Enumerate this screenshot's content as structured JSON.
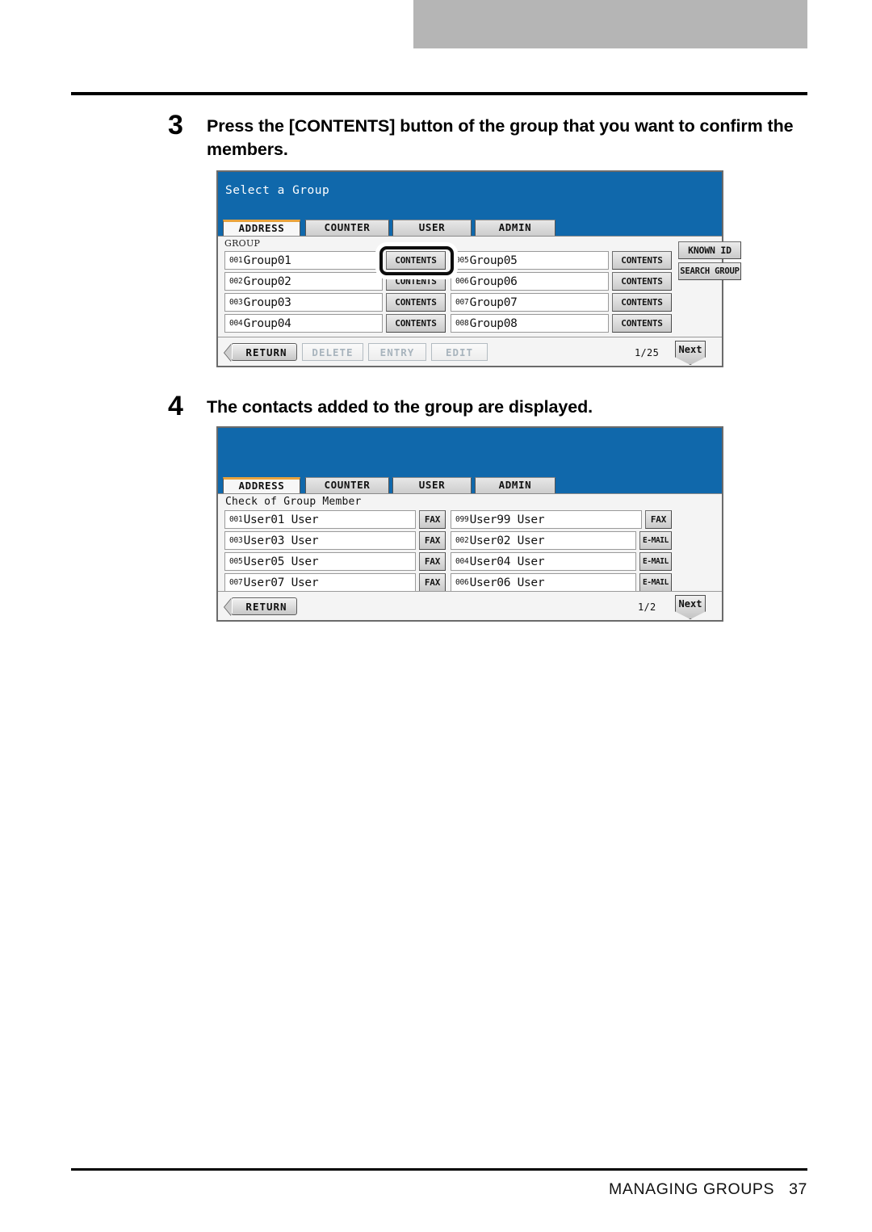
{
  "footer": {
    "chapter": "MANAGING GROUPS",
    "page_number": "37"
  },
  "steps": [
    {
      "number": "3",
      "text": "Press the [CONTENTS] button of the group that you want to confirm the members."
    },
    {
      "number": "4",
      "text": "The contacts added to the group are displayed."
    }
  ],
  "panel1": {
    "header_title": "Select a Group",
    "tabs": [
      {
        "label": "ADDRESS",
        "active": true
      },
      {
        "label": "COUNTER",
        "active": false
      },
      {
        "label": "USER",
        "active": false
      },
      {
        "label": "ADMIN",
        "active": false
      }
    ],
    "section_label": "GROUP",
    "left_rows": [
      {
        "index": "001",
        "name": "Group01",
        "button": "CONTENTS"
      },
      {
        "index": "002",
        "name": "Group02",
        "button": "CONTENTS"
      },
      {
        "index": "003",
        "name": "Group03",
        "button": "CONTENTS"
      },
      {
        "index": "004",
        "name": "Group04",
        "button": "CONTENTS"
      }
    ],
    "right_rows": [
      {
        "index": "005",
        "name": "Group05",
        "button": "CONTENTS"
      },
      {
        "index": "006",
        "name": "Group06",
        "button": "CONTENTS"
      },
      {
        "index": "007",
        "name": "Group07",
        "button": "CONTENTS"
      },
      {
        "index": "008",
        "name": "Group08",
        "button": "CONTENTS"
      }
    ],
    "side_buttons": [
      {
        "label": "KNOWN ID"
      },
      {
        "label": "SEARCH GROUP"
      }
    ],
    "footer_buttons": [
      {
        "label": "RETURN",
        "enabled": true
      },
      {
        "label": "DELETE",
        "enabled": false
      },
      {
        "label": "ENTRY",
        "enabled": false
      },
      {
        "label": "EDIT",
        "enabled": false
      }
    ],
    "page_indicator": "1/25",
    "next_label": "Next",
    "highlighted_button": "CONTENTS"
  },
  "panel2": {
    "header_title": "",
    "tabs": [
      {
        "label": "ADDRESS",
        "active": true
      },
      {
        "label": "COUNTER",
        "active": false
      },
      {
        "label": "USER",
        "active": false
      },
      {
        "label": "ADMIN",
        "active": false
      }
    ],
    "screen_title": "Check of Group Member",
    "left_rows": [
      {
        "index": "001",
        "name": "User01 User",
        "button": "FAX"
      },
      {
        "index": "003",
        "name": "User03 User",
        "button": "FAX"
      },
      {
        "index": "005",
        "name": "User05 User",
        "button": "FAX"
      },
      {
        "index": "007",
        "name": "User07 User",
        "button": "FAX"
      }
    ],
    "right_rows": [
      {
        "index": "099",
        "name": "User99 User",
        "button": "FAX"
      },
      {
        "index": "002",
        "name": "User02 User",
        "button": "E-MAIL"
      },
      {
        "index": "004",
        "name": "User04 User",
        "button": "E-MAIL"
      },
      {
        "index": "006",
        "name": "User06 User",
        "button": "E-MAIL"
      }
    ],
    "footer_buttons": [
      {
        "label": "RETURN",
        "enabled": true
      }
    ],
    "page_indicator": "1/2",
    "next_label": "Next"
  },
  "colors": {
    "panel_blue": "#1068ab",
    "tab_accent": "#e8a33d",
    "header_grey": "#b5b5b5"
  }
}
